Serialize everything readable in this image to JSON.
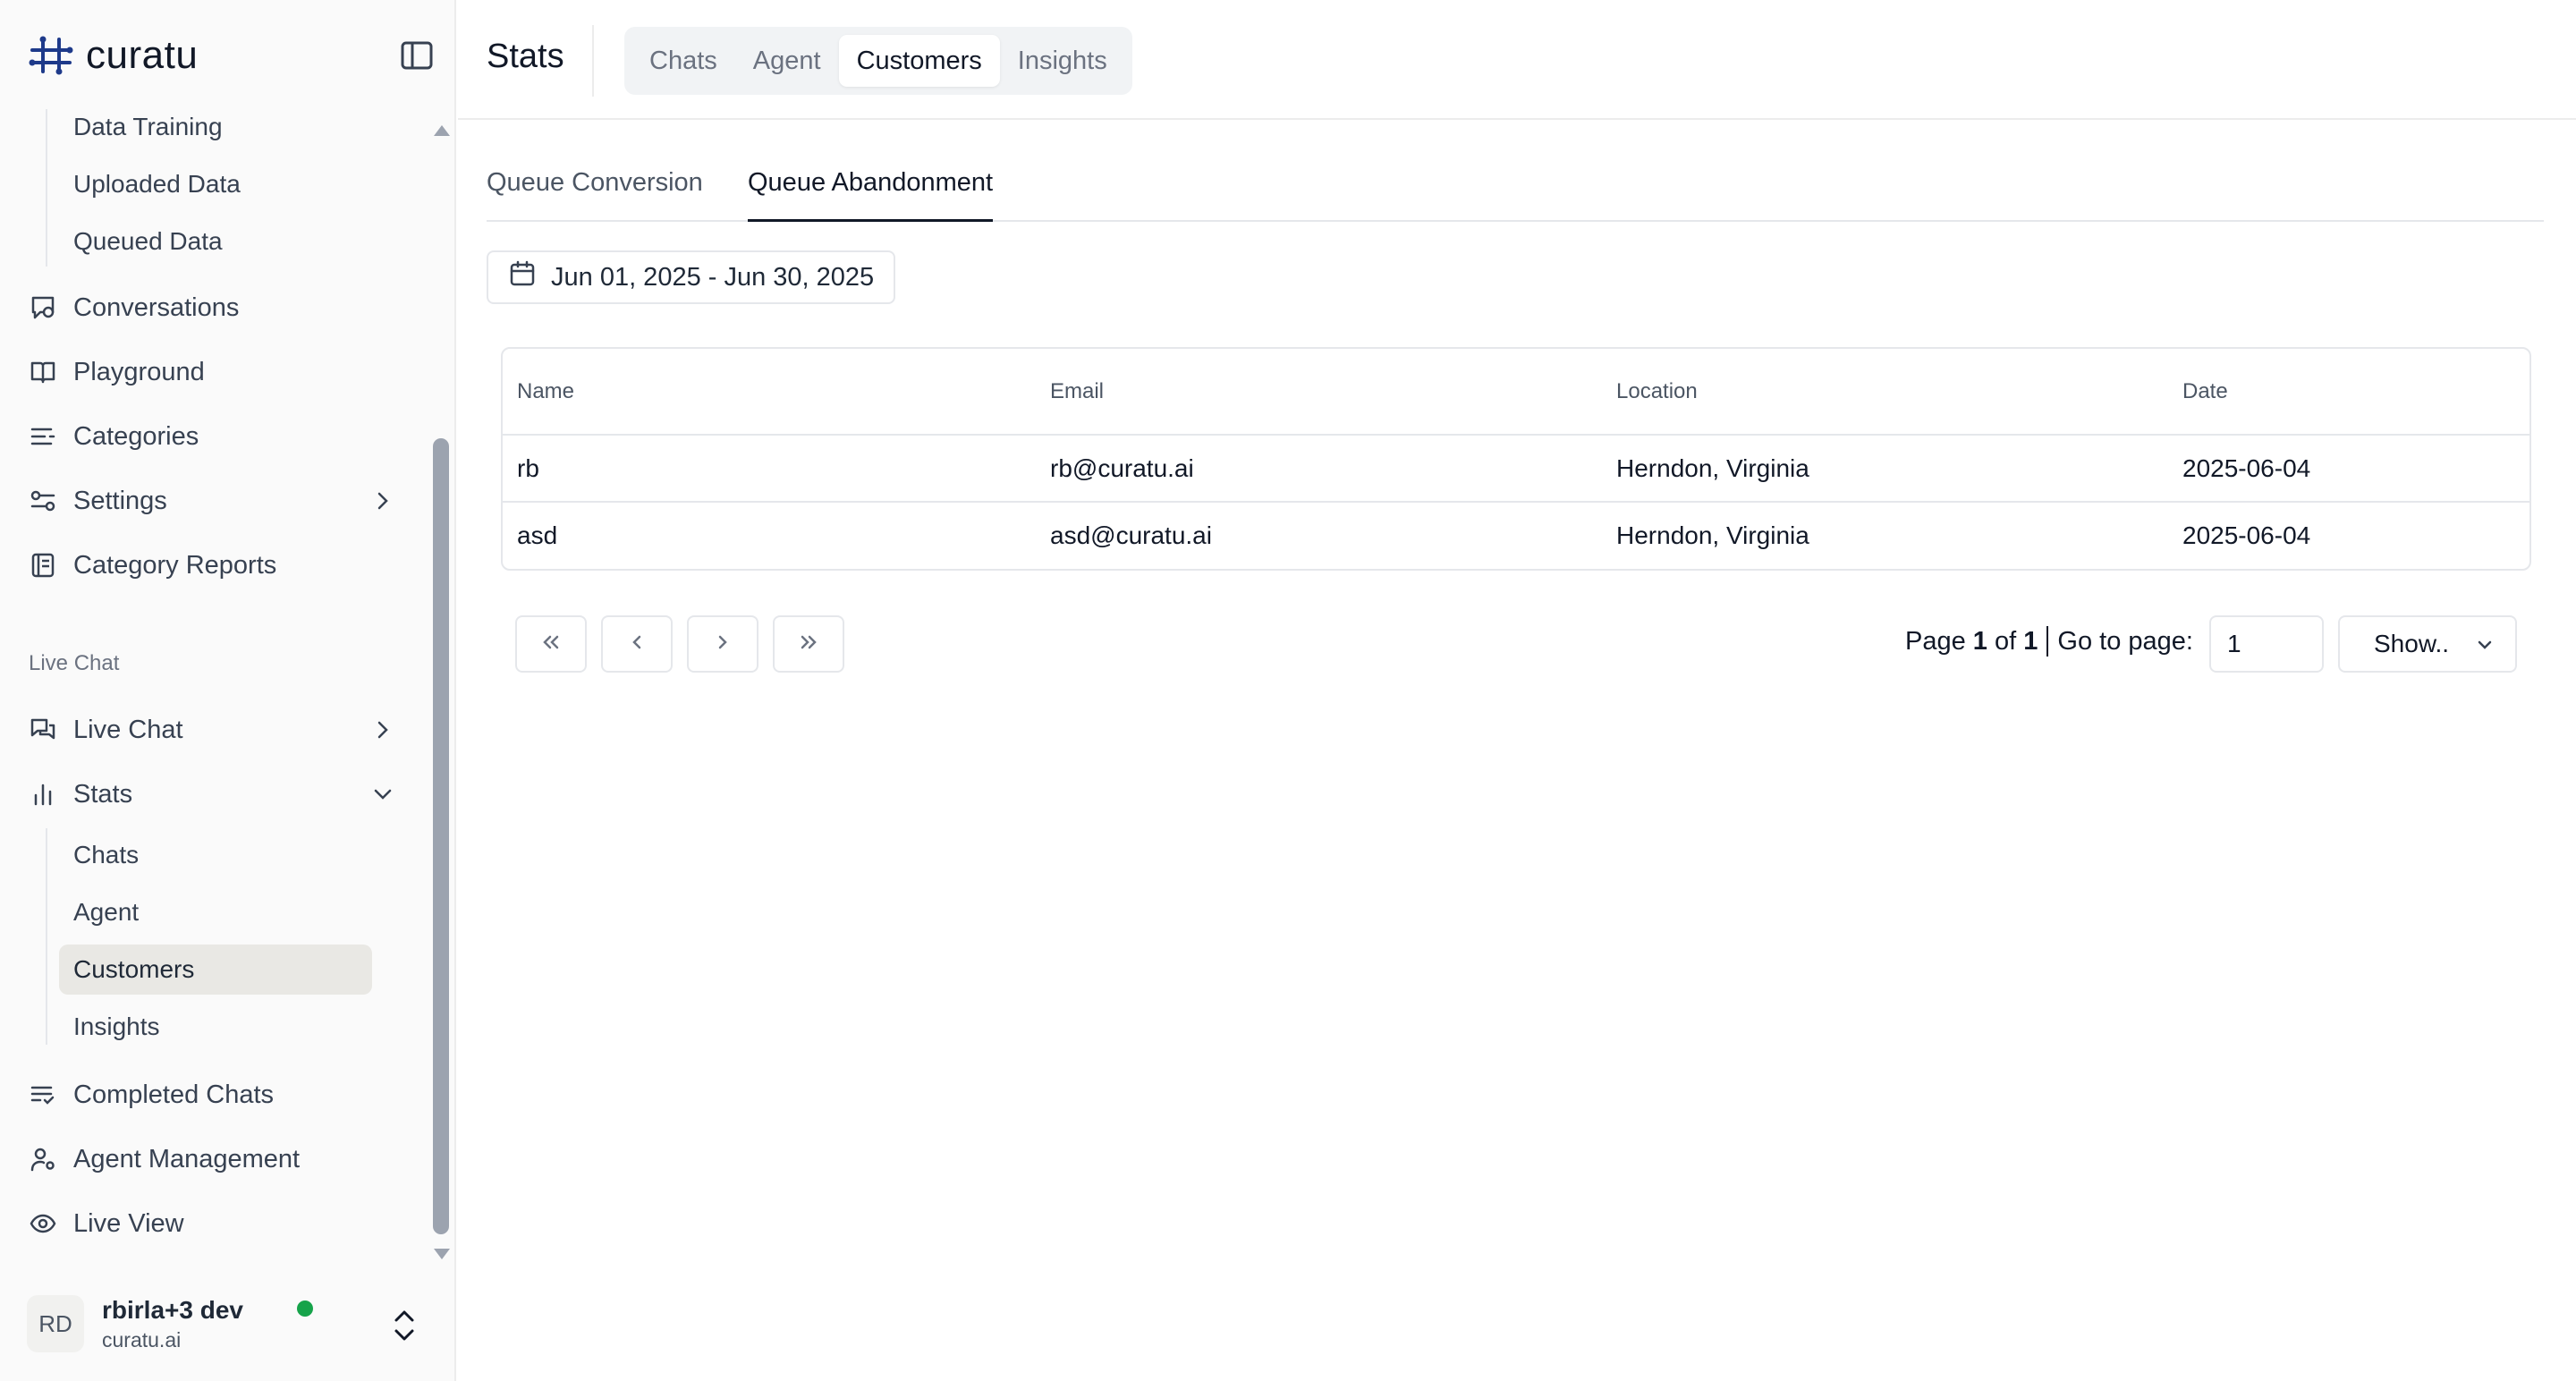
{
  "brand": {
    "name": "curatu",
    "accent_color": "#1e3a8a"
  },
  "sidebar": {
    "top_sub_items": [
      {
        "label": "Data Training"
      },
      {
        "label": "Uploaded Data"
      },
      {
        "label": "Queued Data"
      }
    ],
    "items": [
      {
        "label": "Conversations",
        "icon": "conversations-icon"
      },
      {
        "label": "Playground",
        "icon": "book-icon"
      },
      {
        "label": "Categories",
        "icon": "list-icon"
      },
      {
        "label": "Settings",
        "icon": "sliders-icon",
        "has_chevron": true
      },
      {
        "label": "Category Reports",
        "icon": "report-icon"
      }
    ],
    "section_label": "Live Chat",
    "live_items": [
      {
        "label": "Live Chat",
        "icon": "chat-icon",
        "has_chevron": true
      },
      {
        "label": "Stats",
        "icon": "bar-chart-icon",
        "expanded": true
      }
    ],
    "stats_sub_items": [
      {
        "label": "Chats"
      },
      {
        "label": "Agent"
      },
      {
        "label": "Customers",
        "active": true
      },
      {
        "label": "Insights"
      }
    ],
    "bottom_items": [
      {
        "label": "Completed Chats",
        "icon": "checklist-icon"
      },
      {
        "label": "Agent Management",
        "icon": "user-gear-icon"
      },
      {
        "label": "Live View",
        "icon": "eye-icon"
      }
    ]
  },
  "user": {
    "initials": "RD",
    "name": "rbirla+3 dev",
    "org": "curatu.ai",
    "status_color": "#16a34a"
  },
  "header": {
    "title": "Stats",
    "tabs": [
      {
        "label": "Chats"
      },
      {
        "label": "Agent"
      },
      {
        "label": "Customers",
        "active": true
      },
      {
        "label": "Insights"
      }
    ]
  },
  "subtabs": [
    {
      "label": "Queue Conversion"
    },
    {
      "label": "Queue Abandonment",
      "active": true
    }
  ],
  "date_range": "Jun 01, 2025 - Jun 30, 2025",
  "table": {
    "columns": [
      "Name",
      "Email",
      "Location",
      "Date"
    ],
    "rows": [
      [
        "rb",
        "rb@curatu.ai",
        "Herndon, Virginia",
        "2025-06-04"
      ],
      [
        "asd",
        "asd@curatu.ai",
        "Herndon, Virginia",
        "2025-06-04"
      ]
    ]
  },
  "pagination": {
    "page_word": "Page",
    "current": "1",
    "of_word": "of",
    "total": "1",
    "goto_label": "Go to page:",
    "goto_value": "1",
    "show_label": "Show.."
  }
}
